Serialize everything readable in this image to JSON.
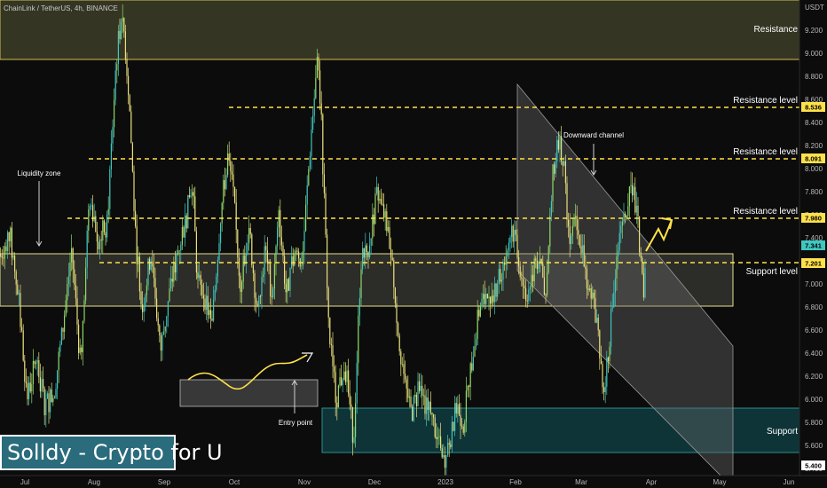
{
  "header": {
    "title": "ChainLink / TetherUS, 4h, BINANCE",
    "currency": "USDT"
  },
  "watermark": "Solldy - Crypto for U",
  "colors": {
    "background": "#0c0c0c",
    "candle_up": "#8fd86a",
    "candle_up_alt": "#3fc7c0",
    "candle_down": "#e9df7a",
    "zone_border": "#e5d55a",
    "level_line": "#ffe24a",
    "support_fill": "#0e3438",
    "support_border": "#2b8f8f",
    "channel_fill": "#5a5a5a"
  },
  "annotations": {
    "resistance_top": "Resistance",
    "resistance_1": "Resistance level",
    "resistance_2": "Resistance level",
    "resistance_3": "Resistance level",
    "support_level": "Support level",
    "support_bottom": "Support",
    "liquidity_zone": "Liquidity zone",
    "downward_channel": "Downward channel",
    "entry_point": "Entry point"
  },
  "price_badges": {
    "b1": "8.536",
    "b2": "8.091",
    "b3": "7.980",
    "b4": "7.341",
    "b5": "7.201",
    "b6": "5.400"
  },
  "chart_data": {
    "type": "candlestick",
    "timeframe": "4h",
    "y_ticks": [
      "9.200",
      "9.000",
      "8.800",
      "8.600",
      "8.400",
      "8.200",
      "8.000",
      "7.800",
      "7.600",
      "7.400",
      "7.200",
      "7.000",
      "6.800",
      "6.600",
      "6.400",
      "6.200",
      "6.000",
      "5.800",
      "5.600",
      "5.400"
    ],
    "x_ticks": [
      "Jul",
      "Aug",
      "Sep",
      "Oct",
      "Nov",
      "Dec",
      "2023",
      "Feb",
      "Mar",
      "Apr",
      "May",
      "Jun"
    ],
    "price_path": [
      [
        0,
        7.25
      ],
      [
        10,
        7.45
      ],
      [
        20,
        6.9
      ],
      [
        30,
        6.0
      ],
      [
        40,
        6.35
      ],
      [
        50,
        5.95
      ],
      [
        60,
        6.05
      ],
      [
        70,
        6.6
      ],
      [
        80,
        7.3
      ],
      [
        90,
        6.3
      ],
      [
        100,
        7.8
      ],
      [
        110,
        7.4
      ],
      [
        120,
        7.5
      ],
      [
        130,
        8.9
      ],
      [
        137,
        9.4
      ],
      [
        145,
        8.6
      ],
      [
        152,
        7.4
      ],
      [
        160,
        6.8
      ],
      [
        170,
        7.3
      ],
      [
        180,
        6.4
      ],
      [
        190,
        6.9
      ],
      [
        200,
        7.3
      ],
      [
        210,
        7.6
      ],
      [
        216,
        7.9
      ],
      [
        222,
        7.0
      ],
      [
        230,
        6.9
      ],
      [
        238,
        6.6
      ],
      [
        248,
        7.6
      ],
      [
        256,
        8.1
      ],
      [
        262,
        7.8
      ],
      [
        270,
        7.0
      ],
      [
        280,
        7.5
      ],
      [
        290,
        6.7
      ],
      [
        298,
        7.3
      ],
      [
        306,
        6.9
      ],
      [
        314,
        7.6
      ],
      [
        322,
        6.9
      ],
      [
        332,
        7.3
      ],
      [
        340,
        7.2
      ],
      [
        350,
        8.3
      ],
      [
        358,
        9.0
      ],
      [
        362,
        8.3
      ],
      [
        370,
        6.6
      ],
      [
        378,
        6.0
      ],
      [
        388,
        6.3
      ],
      [
        398,
        5.65
      ],
      [
        406,
        7.2
      ],
      [
        414,
        7.3
      ],
      [
        424,
        7.75
      ],
      [
        432,
        7.6
      ],
      [
        440,
        7.3
      ],
      [
        448,
        6.6
      ],
      [
        456,
        6.1
      ],
      [
        464,
        5.9
      ],
      [
        472,
        6.1
      ],
      [
        480,
        5.95
      ],
      [
        490,
        5.75
      ],
      [
        498,
        5.45
      ],
      [
        506,
        5.6
      ],
      [
        514,
        5.95
      ],
      [
        522,
        5.8
      ],
      [
        530,
        6.3
      ],
      [
        540,
        6.8
      ],
      [
        550,
        6.9
      ],
      [
        560,
        7.0
      ],
      [
        568,
        7.2
      ],
      [
        576,
        7.5
      ],
      [
        584,
        7.2
      ],
      [
        592,
        6.9
      ],
      [
        600,
        7.1
      ],
      [
        608,
        7.3
      ],
      [
        614,
        6.8
      ],
      [
        622,
        7.9
      ],
      [
        628,
        8.3
      ],
      [
        634,
        8.1
      ],
      [
        640,
        7.4
      ],
      [
        648,
        7.5
      ],
      [
        656,
        7.3
      ],
      [
        664,
        6.9
      ],
      [
        672,
        6.7
      ],
      [
        680,
        6.0
      ],
      [
        688,
        6.7
      ],
      [
        696,
        7.3
      ],
      [
        704,
        7.6
      ],
      [
        712,
        7.85
      ],
      [
        718,
        7.6
      ],
      [
        724,
        6.9
      ],
      [
        728,
        7.15
      ]
    ],
    "levels": [
      {
        "label": "Resistance level",
        "price": 8.536
      },
      {
        "label": "Resistance level",
        "price": 8.091
      },
      {
        "label": "Resistance level",
        "price": 7.98
      },
      {
        "label": "Support level",
        "price": 7.201
      }
    ],
    "zones": [
      {
        "label": "Resistance",
        "from": 8.98,
        "to": 9.52
      },
      {
        "label": "Liquidity zone",
        "from": 6.84,
        "to": 7.28
      },
      {
        "label": "Support",
        "from": 5.58,
        "to": 5.95
      }
    ],
    "current_price": 7.341,
    "ylim": [
      5.4,
      9.5
    ]
  }
}
